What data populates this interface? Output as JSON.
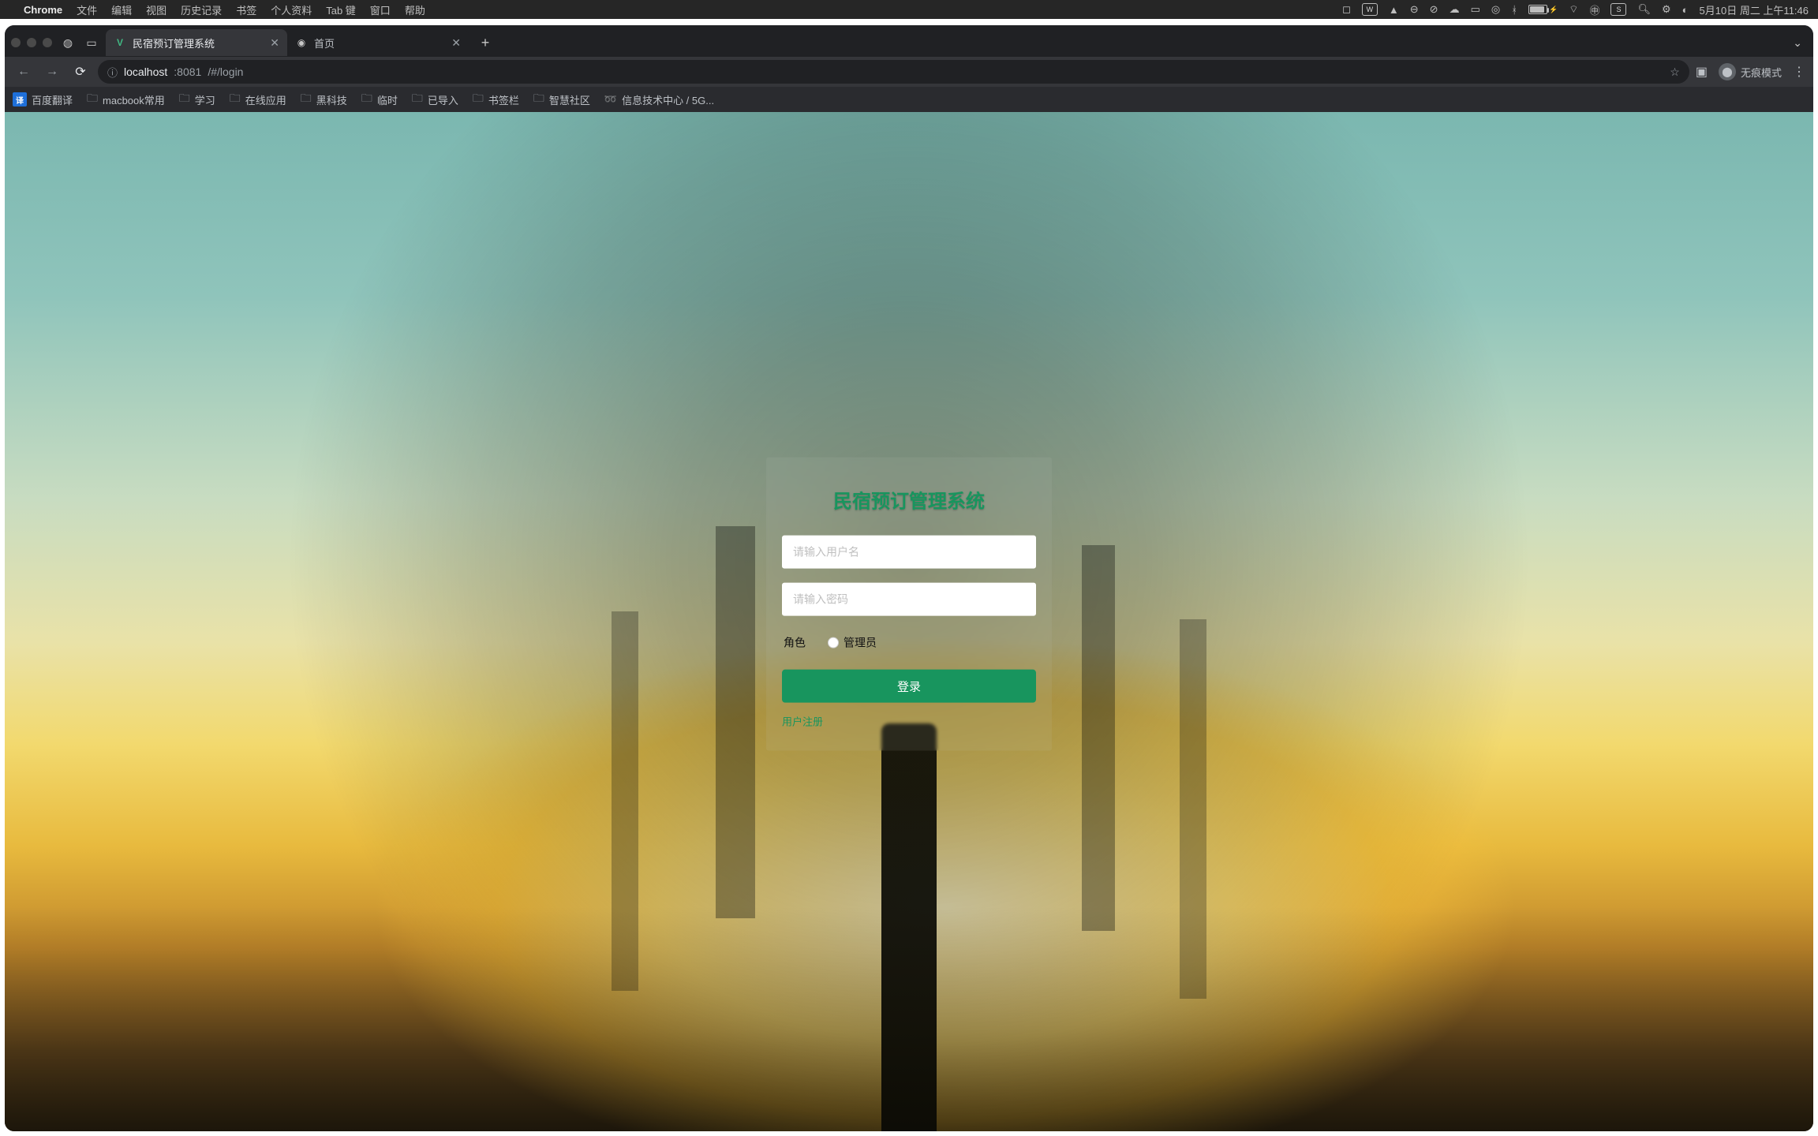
{
  "mac_menubar": {
    "app_name": "Chrome",
    "menus": [
      "文件",
      "编辑",
      "视图",
      "历史记录",
      "书签",
      "个人资料",
      "Tab 键",
      "窗口",
      "帮助"
    ],
    "clock": "5月10日 周二 上午11:46",
    "battery_icon_label": "⚡"
  },
  "browser": {
    "tabs": [
      {
        "title": "民宿预订管理系统",
        "favicon": "V",
        "active": true
      },
      {
        "title": "首页",
        "favicon": "◉",
        "active": false
      }
    ],
    "new_tab_label": "+",
    "back_enabled": false,
    "forward_enabled": false,
    "reload_enabled": true,
    "address": {
      "scheme_icon": "ⓘ",
      "host": "localhost",
      "port": ":8081",
      "path": "/#/login"
    },
    "incognito_label": "无痕模式",
    "bookmarks": [
      {
        "type": "badge",
        "label": "百度翻译",
        "badge": "译"
      },
      {
        "type": "folder",
        "label": "macbook常用"
      },
      {
        "type": "folder",
        "label": "学习"
      },
      {
        "type": "folder",
        "label": "在线应用"
      },
      {
        "type": "folder",
        "label": "黑科技"
      },
      {
        "type": "folder",
        "label": "临时"
      },
      {
        "type": "folder",
        "label": "已导入"
      },
      {
        "type": "folder",
        "label": "书签栏"
      },
      {
        "type": "folder",
        "label": "智慧社区"
      },
      {
        "type": "link",
        "label": "信息技术中心 / 5G..."
      }
    ]
  },
  "login": {
    "title": "民宿预订管理系统",
    "username_placeholder": "请输入用户名",
    "password_placeholder": "请输入密码",
    "role_label": "角色",
    "role_option_admin": "管理员",
    "submit_label": "登录",
    "register_label": "用户注册"
  }
}
